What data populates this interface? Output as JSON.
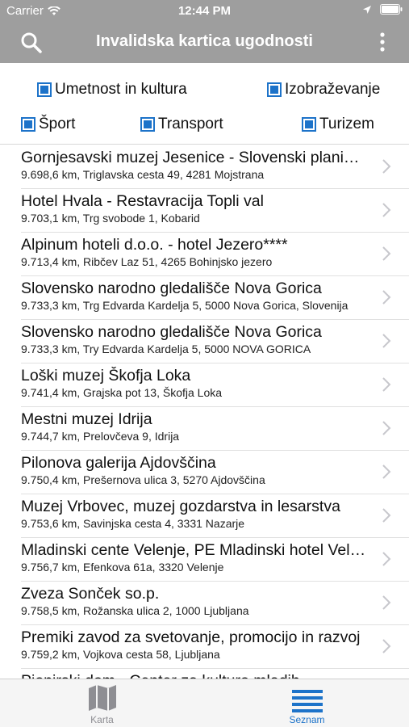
{
  "status": {
    "carrier": "Carrier",
    "time": "12:44 PM"
  },
  "navbar": {
    "title": "Invalidska kartica ugodnosti"
  },
  "filters": [
    {
      "label": "Umetnost in kultura",
      "checked": true
    },
    {
      "label": "Izobraževanje",
      "checked": true
    },
    {
      "label": "Šport",
      "checked": true
    },
    {
      "label": "Transport",
      "checked": true
    },
    {
      "label": "Turizem",
      "checked": true
    }
  ],
  "list": [
    {
      "name": "Gornjesavski muzej Jesenice - Slovenski planinski muzej",
      "sub": "9.698,6 km, Triglavska cesta 49, 4281 Mojstrana"
    },
    {
      "name": "Hotel Hvala - Restavracija Topli val",
      "sub": "9.703,1 km, Trg svobode 1, Kobarid"
    },
    {
      "name": "Alpinum hoteli d.o.o. - hotel Jezero****",
      "sub": "9.713,4 km, Ribčev Laz 51, 4265 Bohinjsko jezero"
    },
    {
      "name": "Slovensko narodno gledališče Nova Gorica",
      "sub": "9.733,3 km, Trg Edvarda Kardelja 5, 5000 Nova Gorica, Slovenija"
    },
    {
      "name": "Slovensko narodno gledališče Nova Gorica",
      "sub": "9.733,3 km, Try Edvarda Kardelja 5, 5000 NOVA GORICA"
    },
    {
      "name": "Loški muzej Škofja Loka",
      "sub": "9.741,4 km, Grajska pot 13, Škofja Loka"
    },
    {
      "name": "Mestni muzej Idrija",
      "sub": "9.744,7 km, Prelovčeva 9, Idrija"
    },
    {
      "name": "Pilonova galerija Ajdovščina",
      "sub": "9.750,4 km, Prešernova ulica 3, 5270 Ajdovščina"
    },
    {
      "name": "Muzej Vrbovec, muzej gozdarstva in lesarstva",
      "sub": "9.753,6 km, Savinjska cesta 4, 3331 Nazarje"
    },
    {
      "name": "Mladinski cente Velenje, PE Mladinski hotel Velenje",
      "sub": "9.756,7 km, Efenkova 61a, 3320 Velenje"
    },
    {
      "name": "Zveza Sonček so.p.",
      "sub": "9.758,5 km, Rožanska ulica 2, 1000 Ljubljana"
    },
    {
      "name": "Premiki zavod za svetovanje, promocijo in razvoj",
      "sub": "9.759,2 km, Vojkova cesta 58, Ljubljana"
    },
    {
      "name": "Pionirski dom - Center za kulturo mladih",
      "sub": ""
    }
  ],
  "tabs": [
    {
      "label": "Karta",
      "icon": "map-icon",
      "color": "#8e8e93"
    },
    {
      "label": "Seznam",
      "icon": "list-icon",
      "color": "#1d73c9"
    }
  ],
  "colors": {
    "bar": "#9e9e9e",
    "accent": "#1d73c9"
  }
}
